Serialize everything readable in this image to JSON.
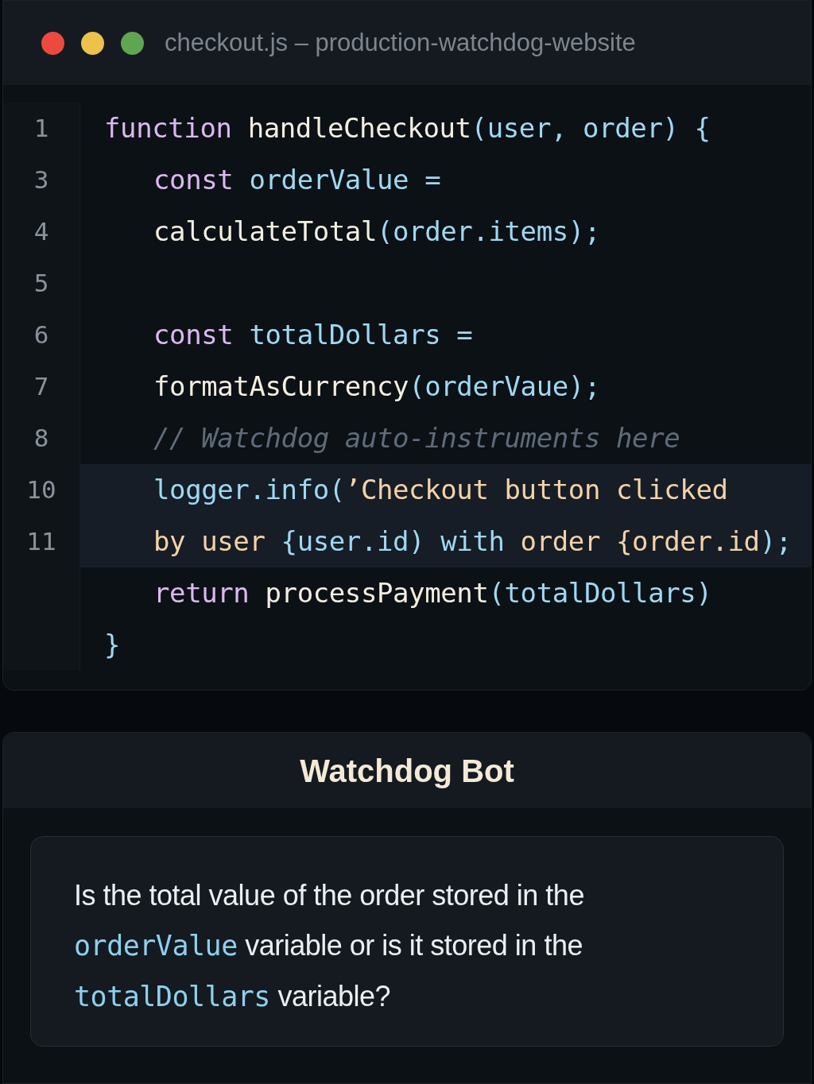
{
  "editor": {
    "title": "checkout.js – production-watchdog-website",
    "lines": [
      {
        "number": "1",
        "indented": false,
        "highlighted": false,
        "tokens": [
          {
            "kind": "keyword",
            "text": "function"
          },
          {
            "kind": "function",
            "text": " handleCheckout"
          },
          {
            "kind": "variable",
            "text": "(user, order) {"
          }
        ]
      },
      {
        "number": "3",
        "indented": true,
        "highlighted": false,
        "tokens": [
          {
            "kind": "keyword",
            "text": "const"
          },
          {
            "kind": "variable",
            "text": " orderValue ="
          }
        ]
      },
      {
        "number": "4",
        "indented": true,
        "highlighted": false,
        "tokens": [
          {
            "kind": "function",
            "text": "calculateTotal"
          },
          {
            "kind": "variable",
            "text": "(order.items);"
          }
        ]
      },
      {
        "number": "5",
        "highlighted": false
      },
      {
        "number": "6",
        "indented": true,
        "highlighted": false,
        "tokens": [
          {
            "kind": "keyword",
            "text": "const"
          },
          {
            "kind": "variable",
            "text": " totalDollars ="
          }
        ]
      },
      {
        "number": "7",
        "indented": true,
        "highlighted": false,
        "tokens": [
          {
            "kind": "function",
            "text": "formatAsCurrency"
          },
          {
            "kind": "variable",
            "text": "(orderVaue);"
          }
        ]
      },
      {
        "number": "8",
        "indented": true,
        "highlighted": false,
        "tokens": [
          {
            "kind": "comment",
            "text": "// Watchdog auto-instruments here"
          }
        ]
      },
      {
        "number": "10",
        "indented": true,
        "highlighted": true,
        "tokens": [
          {
            "kind": "variable",
            "text": "logger.info("
          },
          {
            "kind": "string",
            "text": "’Checkout button clicked"
          }
        ]
      },
      {
        "number": "11",
        "indented": true,
        "highlighted": true,
        "tokens": [
          {
            "kind": "string",
            "text": "by user "
          },
          {
            "kind": "variable",
            "text": "{user.id) with "
          },
          {
            "kind": "string",
            "text": "order {order.id"
          },
          {
            "kind": "variable",
            "text": ");"
          }
        ]
      },
      {
        "indented": true,
        "highlighted": false,
        "tokens": [
          {
            "kind": "keyword",
            "text": "return"
          },
          {
            "kind": "function",
            "text": " processPayment"
          },
          {
            "kind": "variable",
            "text": "(totalDollars)"
          }
        ]
      },
      {
        "indented": false,
        "highlighted": false,
        "tokens": [
          {
            "kind": "variable",
            "text": "}"
          }
        ]
      }
    ]
  },
  "chat": {
    "title": "Watchdog Bot",
    "message": [
      {
        "kind": "text",
        "text": "Is the total value of the order stored in the "
      },
      {
        "kind": "code",
        "text": "orderValue"
      },
      {
        "kind": "text",
        "text": " variable or is it stored in the "
      },
      {
        "kind": "code",
        "text": "totalDollars"
      },
      {
        "kind": "text",
        "text": " variable?"
      }
    ]
  }
}
